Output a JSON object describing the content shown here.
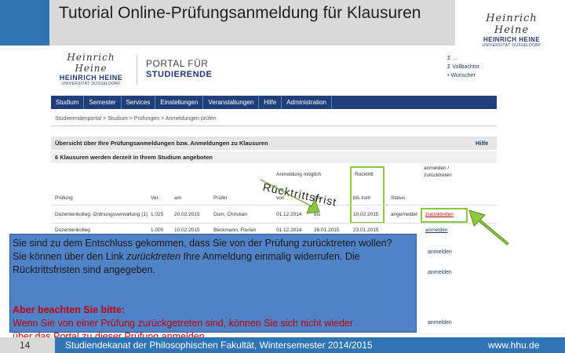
{
  "slide": {
    "title": "Tutorial Online-Prüfungsanmeldung für Klausuren",
    "logo_signature": "Heinrich Heine",
    "logo_name": "HEINRICH HEINE",
    "logo_sub": "UNIVERSITÄT DÜSSELDORF",
    "page_number": "14",
    "footer_text": "Studiendekanat der Philosophischen Fakultät, Wintersemester 2014/2015",
    "footer_url": "www.hhu.de",
    "colors": {
      "accent_blue": "#2f74b5",
      "callout_blue": "#4f82c6",
      "highlight_green": "#8dc63f",
      "warning_red": "#c00000"
    }
  },
  "portal": {
    "header_line1": "PORTAL FÜR",
    "header_line2": "STUDIERENDE",
    "quicklinks": [
      "Σ ...",
      "Σ Vollbachtor",
      "• Wunscher"
    ],
    "nav": [
      "Studium",
      "Semester",
      "Services",
      "Einstellungen",
      "Veranstaltungen",
      "Hilfe",
      "Administration"
    ],
    "breadcrumb": "Studierendenportal > Studium > Prüfungen > Anmeldungen prüfen",
    "panel_title": "Übersicht über Ihre Prüfungsanmeldungen bzw. Anmeldungen zu Klausuren",
    "panel_help": "Hilfe",
    "panel_subtitle": "6 Klausuren werden derzeit in Ihrem Studium angeboten",
    "table": {
      "group_headers": {
        "anmeldung": "Anmeldung möglich",
        "ruecktritt": "Rücktritt"
      },
      "headers": [
        "Prüfung",
        "Ver.",
        "am",
        "Prüfer",
        "von",
        "bis",
        "bis zum",
        "Status",
        "anmelden / zurücktreten"
      ],
      "rows": [
        [
          "Dozentenkolleg: Ordnungsverwaltung (1)",
          "1.025",
          "20.02.2015",
          "Dum, Christian",
          "01.12.2014",
          "bis",
          "10.02.2015",
          "angemeldet",
          "zurücktreten"
        ],
        [
          "Dozentenkolleg",
          "1.000",
          "10.02.2015",
          "Beckmann, Florian",
          "01.12.2014",
          "26.01.2015",
          "23.01.2015",
          "",
          "anmelden"
        ]
      ],
      "side_links": [
        "anmelden",
        "anmelden",
        "anmelden"
      ]
    },
    "overlay_text": "Rücktrittsfrist"
  },
  "callout": {
    "text1": "Sie sind zu dem Entschluss gekommen, dass Sie von der Prüfung zurücktreten wollen?",
    "text2_prefix": "Sie können über den Link ",
    "text2_link": "zurücktreten",
    "text2_suffix": " Ihre Anmeldung einmalig widerrufen. Die Rücktrittsfristen sind angegeben.",
    "warning_title": "Aber beachten Sie bitte:",
    "warning_text": "Wenn Sie von einer Prüfung zurückgetreten sind, können Sie sich nicht wieder",
    "warning_overflow": "über das Portal zu dieser Prüfung anmelden."
  }
}
